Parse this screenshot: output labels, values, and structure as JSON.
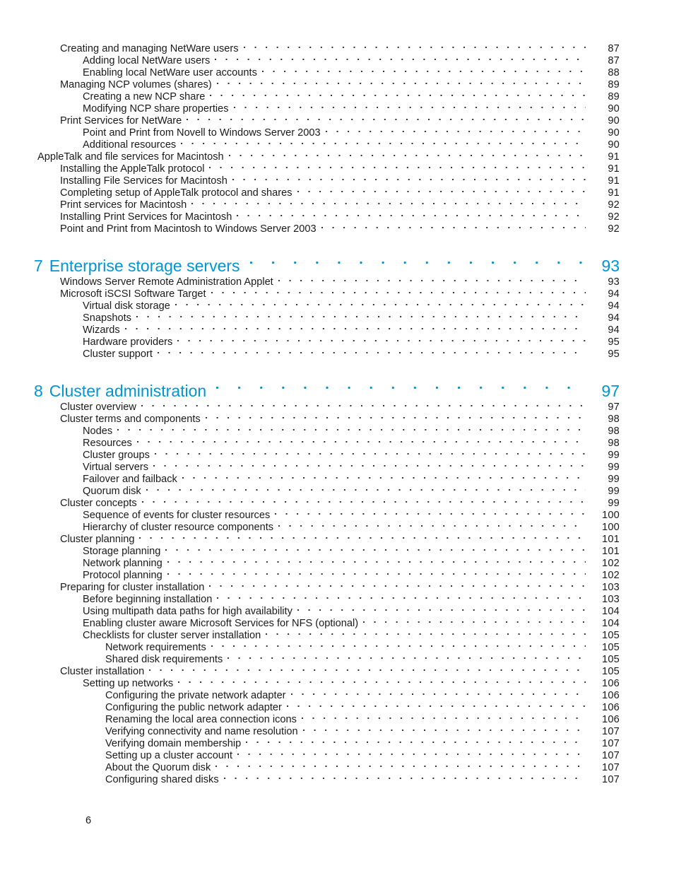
{
  "document": {
    "footer_page_number": "6",
    "accent_color": "#0096d6",
    "text_color": "#1a1a1a"
  },
  "toc": {
    "blocks": [
      {
        "type": "entries",
        "entries": [
          {
            "level": 1,
            "label": "Creating and managing NetWare users",
            "page": "87"
          },
          {
            "level": 2,
            "label": "Adding local NetWare users",
            "page": "87"
          },
          {
            "level": 2,
            "label": "Enabling local NetWare user accounts",
            "page": "88"
          },
          {
            "level": 1,
            "label": "Managing NCP volumes (shares)",
            "page": "89"
          },
          {
            "level": 2,
            "label": "Creating a new NCP share",
            "page": "89"
          },
          {
            "level": 2,
            "label": "Modifying NCP share properties",
            "page": "90"
          },
          {
            "level": 1,
            "label": "Print Services for NetWare",
            "page": "90"
          },
          {
            "level": 2,
            "label": "Point and Print from Novell to Windows Server 2003",
            "page": "90"
          },
          {
            "level": 2,
            "label": "Additional resources",
            "page": "90"
          },
          {
            "level": 0,
            "label": "AppleTalk and file services for Macintosh",
            "page": "91"
          },
          {
            "level": 1,
            "label": "Installing the AppleTalk protocol",
            "page": "91"
          },
          {
            "level": 1,
            "label": "Installing File Services for Macintosh",
            "page": "91"
          },
          {
            "level": 1,
            "label": "Completing setup of AppleTalk protocol and shares",
            "page": "91"
          },
          {
            "level": 1,
            "label": "Print services for Macintosh",
            "page": "92"
          },
          {
            "level": 1,
            "label": "Installing Print Services for Macintosh",
            "page": "92"
          },
          {
            "level": 1,
            "label": "Point and Print from Macintosh to Windows Server 2003",
            "page": "92"
          }
        ]
      },
      {
        "type": "chapter",
        "number": "7",
        "title": "Enterprise storage servers",
        "page": "93",
        "entries": [
          {
            "level": 1,
            "label": "Windows Server Remote Administration Applet",
            "page": "93"
          },
          {
            "level": 1,
            "label": "Microsoft iSCSI Software Target",
            "page": "94"
          },
          {
            "level": 2,
            "label": "Virtual disk storage",
            "page": "94"
          },
          {
            "level": 2,
            "label": "Snapshots",
            "page": "94"
          },
          {
            "level": 2,
            "label": "Wizards",
            "page": "94"
          },
          {
            "level": 2,
            "label": "Hardware providers",
            "page": "95"
          },
          {
            "level": 2,
            "label": "Cluster support",
            "page": "95"
          }
        ]
      },
      {
        "type": "chapter",
        "number": "8",
        "title": "Cluster administration",
        "page": "97",
        "entries": [
          {
            "level": 1,
            "label": "Cluster overview",
            "page": "97"
          },
          {
            "level": 1,
            "label": "Cluster terms and components",
            "page": "98"
          },
          {
            "level": 2,
            "label": "Nodes",
            "page": "98"
          },
          {
            "level": 2,
            "label": "Resources",
            "page": "98"
          },
          {
            "level": 2,
            "label": "Cluster groups",
            "page": "99"
          },
          {
            "level": 2,
            "label": "Virtual servers",
            "page": "99"
          },
          {
            "level": 2,
            "label": "Failover and failback",
            "page": "99"
          },
          {
            "level": 2,
            "label": "Quorum disk",
            "page": "99"
          },
          {
            "level": 1,
            "label": "Cluster concepts",
            "page": "99"
          },
          {
            "level": 2,
            "label": "Sequence of events for cluster resources",
            "page": "100"
          },
          {
            "level": 2,
            "label": "Hierarchy of cluster resource components",
            "page": "100"
          },
          {
            "level": 1,
            "label": "Cluster planning",
            "page": "101"
          },
          {
            "level": 2,
            "label": "Storage planning",
            "page": "101"
          },
          {
            "level": 2,
            "label": "Network planning",
            "page": "102"
          },
          {
            "level": 2,
            "label": "Protocol planning",
            "page": "102"
          },
          {
            "level": 1,
            "label": "Preparing for cluster installation",
            "page": "103"
          },
          {
            "level": 2,
            "label": "Before beginning installation",
            "page": "103"
          },
          {
            "level": 2,
            "label": "Using multipath data paths for high availability",
            "page": "104"
          },
          {
            "level": 2,
            "label": "Enabling cluster aware Microsoft Services for NFS (optional)",
            "page": "104"
          },
          {
            "level": 2,
            "label": "Checklists for cluster server installation",
            "page": "105"
          },
          {
            "level": 3,
            "label": "Network requirements",
            "page": "105"
          },
          {
            "level": 3,
            "label": "Shared disk requirements",
            "page": "105"
          },
          {
            "level": 1,
            "label": "Cluster installation",
            "page": "105"
          },
          {
            "level": 2,
            "label": "Setting up networks",
            "page": "106"
          },
          {
            "level": 3,
            "label": "Configuring the private network adapter",
            "page": "106"
          },
          {
            "level": 3,
            "label": "Configuring the public network adapter",
            "page": "106"
          },
          {
            "level": 3,
            "label": "Renaming the local area connection icons",
            "page": "106"
          },
          {
            "level": 3,
            "label": "Verifying connectivity and name resolution",
            "page": "107"
          },
          {
            "level": 3,
            "label": "Verifying domain membership",
            "page": "107"
          },
          {
            "level": 3,
            "label": "Setting up a cluster account",
            "page": "107"
          },
          {
            "level": 3,
            "label": "About the Quorum disk",
            "page": "107"
          },
          {
            "level": 3,
            "label": "Configuring shared disks",
            "page": "107"
          }
        ]
      }
    ]
  }
}
